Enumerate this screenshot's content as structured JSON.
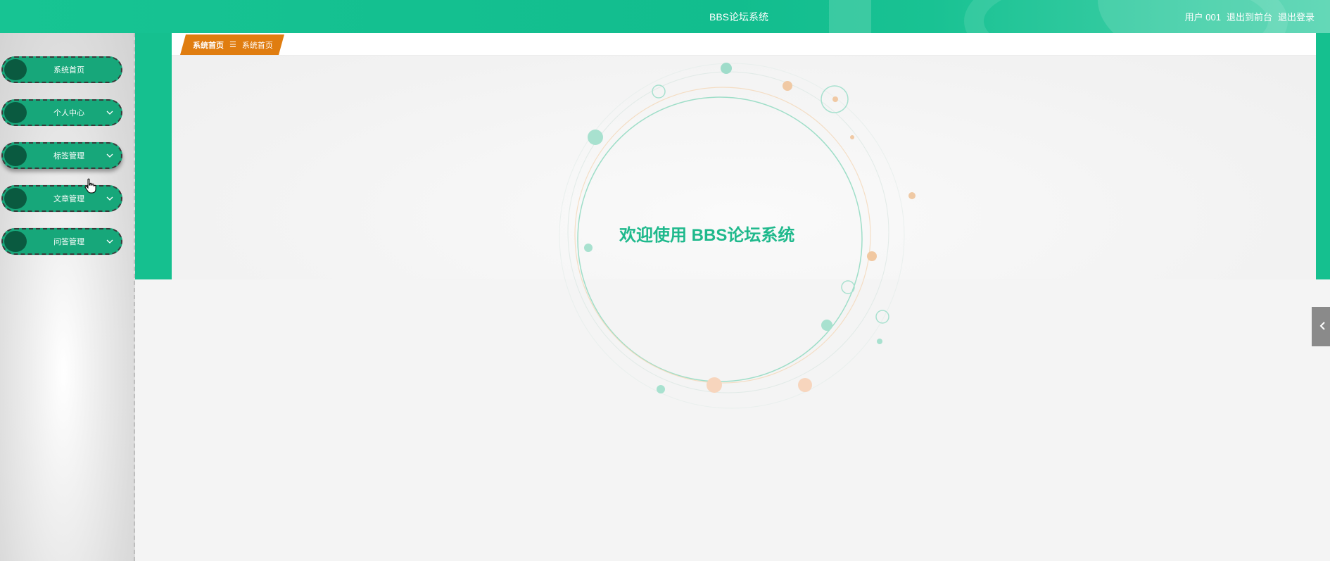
{
  "header": {
    "app_title": "BBS论坛系统",
    "user_label": "用户 001",
    "to_frontend": "退出到前台",
    "logout": "退出登录"
  },
  "sidebar": {
    "items": [
      {
        "label": "系统首页",
        "has_submenu": false
      },
      {
        "label": "个人中心",
        "has_submenu": true
      },
      {
        "label": "标签管理",
        "has_submenu": true
      },
      {
        "label": "文章管理",
        "has_submenu": true
      },
      {
        "label": "问答管理",
        "has_submenu": true
      }
    ]
  },
  "breadcrumb": {
    "home": "系统首页",
    "separator": "☰",
    "current": "系统首页"
  },
  "main": {
    "welcome_text": "欢迎使用 BBS论坛系统"
  },
  "colors": {
    "accent": "#15c08f",
    "menu": "#17a77a",
    "menu_bullet": "#0a5a40",
    "breadcrumb": "#e07d10",
    "welcome": "#1fb98c"
  },
  "icons": {
    "menu_chevron": "chevron-down-icon",
    "side_tab": "chevron-left-icon",
    "cursor": "hand-pointer-icon"
  }
}
